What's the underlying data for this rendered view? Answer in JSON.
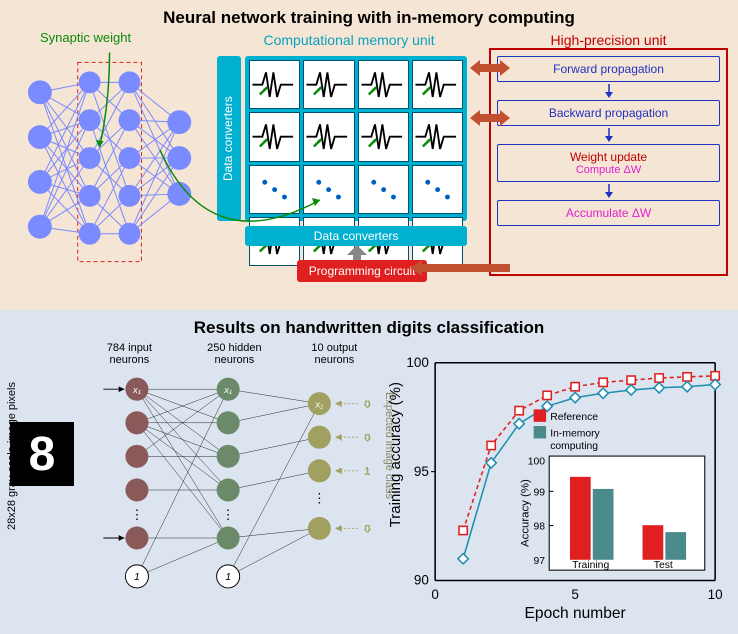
{
  "top": {
    "title": "Neural network training with in-memory computing",
    "synaptic_label": "Synaptic weight",
    "cmu_title": "Computational memory unit",
    "dc_left": "Data converters",
    "dc_bottom": "Data converters",
    "prog_circuit": "Programming circuit",
    "hpu_title": "High-precision unit",
    "hpu_steps": {
      "fwd": "Forward propagation",
      "bwd": "Backward propagation",
      "wu": "Weight update",
      "wu_sub": "Compute ΔW",
      "acc": "Accumulate ΔW"
    }
  },
  "bottom": {
    "title": "Results on handwritten digits classification",
    "mnist_digit": "8",
    "pixels_label": "28x28 gray-scale image pixels",
    "col1": "784 input neurons",
    "col2": "250 hidden neurons",
    "col3": "10 output neurons",
    "expected_label": "Expected image class",
    "target_values": [
      "0",
      "0",
      "1",
      "0"
    ],
    "bias": "1",
    "ylabel": "Training accuracy (%)",
    "xlabel": "Epoch number",
    "inset_ylabel": "Accuracy (%)",
    "legend": {
      "ref": "Reference",
      "imc": "In-memory computing"
    },
    "bar_cats": {
      "train": "Training",
      "test": "Test"
    }
  },
  "chart_data": {
    "type": "line",
    "xlabel": "Epoch number",
    "ylabel": "Training accuracy (%)",
    "xlim": [
      0,
      10
    ],
    "ylim": [
      90,
      100
    ],
    "x": [
      1,
      2,
      3,
      4,
      5,
      6,
      7,
      8,
      9,
      10
    ],
    "series": [
      {
        "name": "Reference",
        "color": "#e02020",
        "marker": "square",
        "style": "dashed",
        "values": [
          92.3,
          96.2,
          97.8,
          98.5,
          98.9,
          99.1,
          99.2,
          99.3,
          99.35,
          99.4
        ]
      },
      {
        "name": "In-memory computing",
        "color": "#2090b0",
        "marker": "diamond",
        "style": "solid",
        "values": [
          91.0,
          95.4,
          97.2,
          98.0,
          98.4,
          98.6,
          98.75,
          98.85,
          98.9,
          99.0
        ]
      }
    ],
    "inset": {
      "type": "bar",
      "ylabel": "Accuracy (%)",
      "ylim": [
        97,
        100
      ],
      "categories": [
        "Training",
        "Test"
      ],
      "series": [
        {
          "name": "Reference",
          "color": "#e02020",
          "values": [
            99.4,
            98.0
          ]
        },
        {
          "name": "In-memory computing",
          "color": "#4a8a8a",
          "values": [
            99.05,
            97.8
          ]
        }
      ]
    }
  }
}
